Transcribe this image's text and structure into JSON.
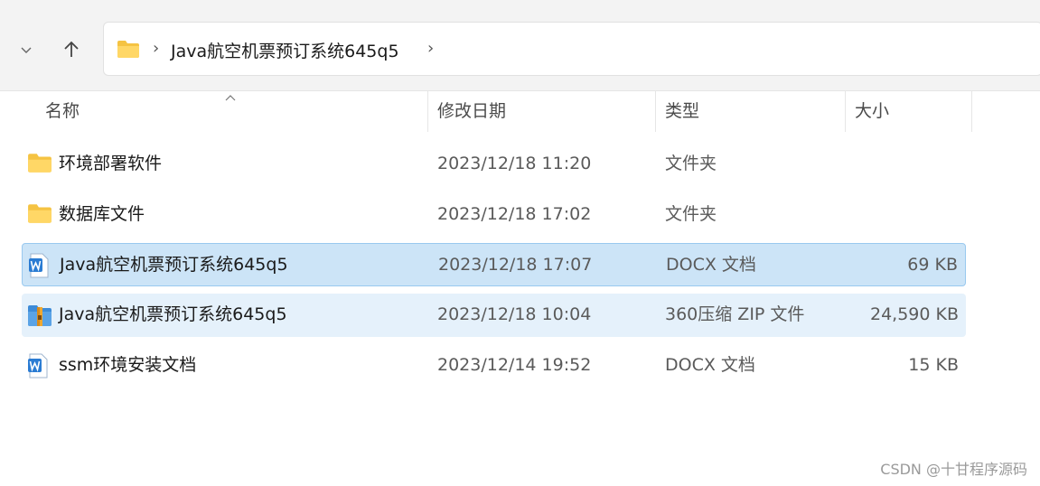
{
  "address_bar": {
    "path": "Java航空机票预订系统645q5"
  },
  "columns": {
    "name": "名称",
    "modified": "修改日期",
    "type": "类型",
    "size": "大小"
  },
  "files": [
    {
      "name": "环境部署软件",
      "modified": "2023/12/18 11:20",
      "type": "文件夹",
      "size": "",
      "icon": "folder-icon"
    },
    {
      "name": "数据库文件",
      "modified": "2023/12/18 17:02",
      "type": "文件夹",
      "size": "",
      "icon": "folder-icon"
    },
    {
      "name": "Java航空机票预订系统645q5",
      "modified": "2023/12/18 17:07",
      "type": "DOCX 文档",
      "size": "69 KB",
      "icon": "word-document-icon"
    },
    {
      "name": "Java航空机票预订系统645q5",
      "modified": "2023/12/18 10:04",
      "type": "360压缩 ZIP 文件",
      "size": "24,590 KB",
      "icon": "zip-archive-icon"
    },
    {
      "name": "ssm环境安装文档",
      "modified": "2023/12/14 19:52",
      "type": "DOCX 文档",
      "size": "15 KB",
      "icon": "word-document-icon"
    }
  ],
  "watermark": "CSDN @十甘程序源码",
  "colors": {
    "selected_row": "#cce4f7",
    "hover_row": "#e5f1fb",
    "folder": "#f5c342",
    "word": "#2b7cd3"
  }
}
